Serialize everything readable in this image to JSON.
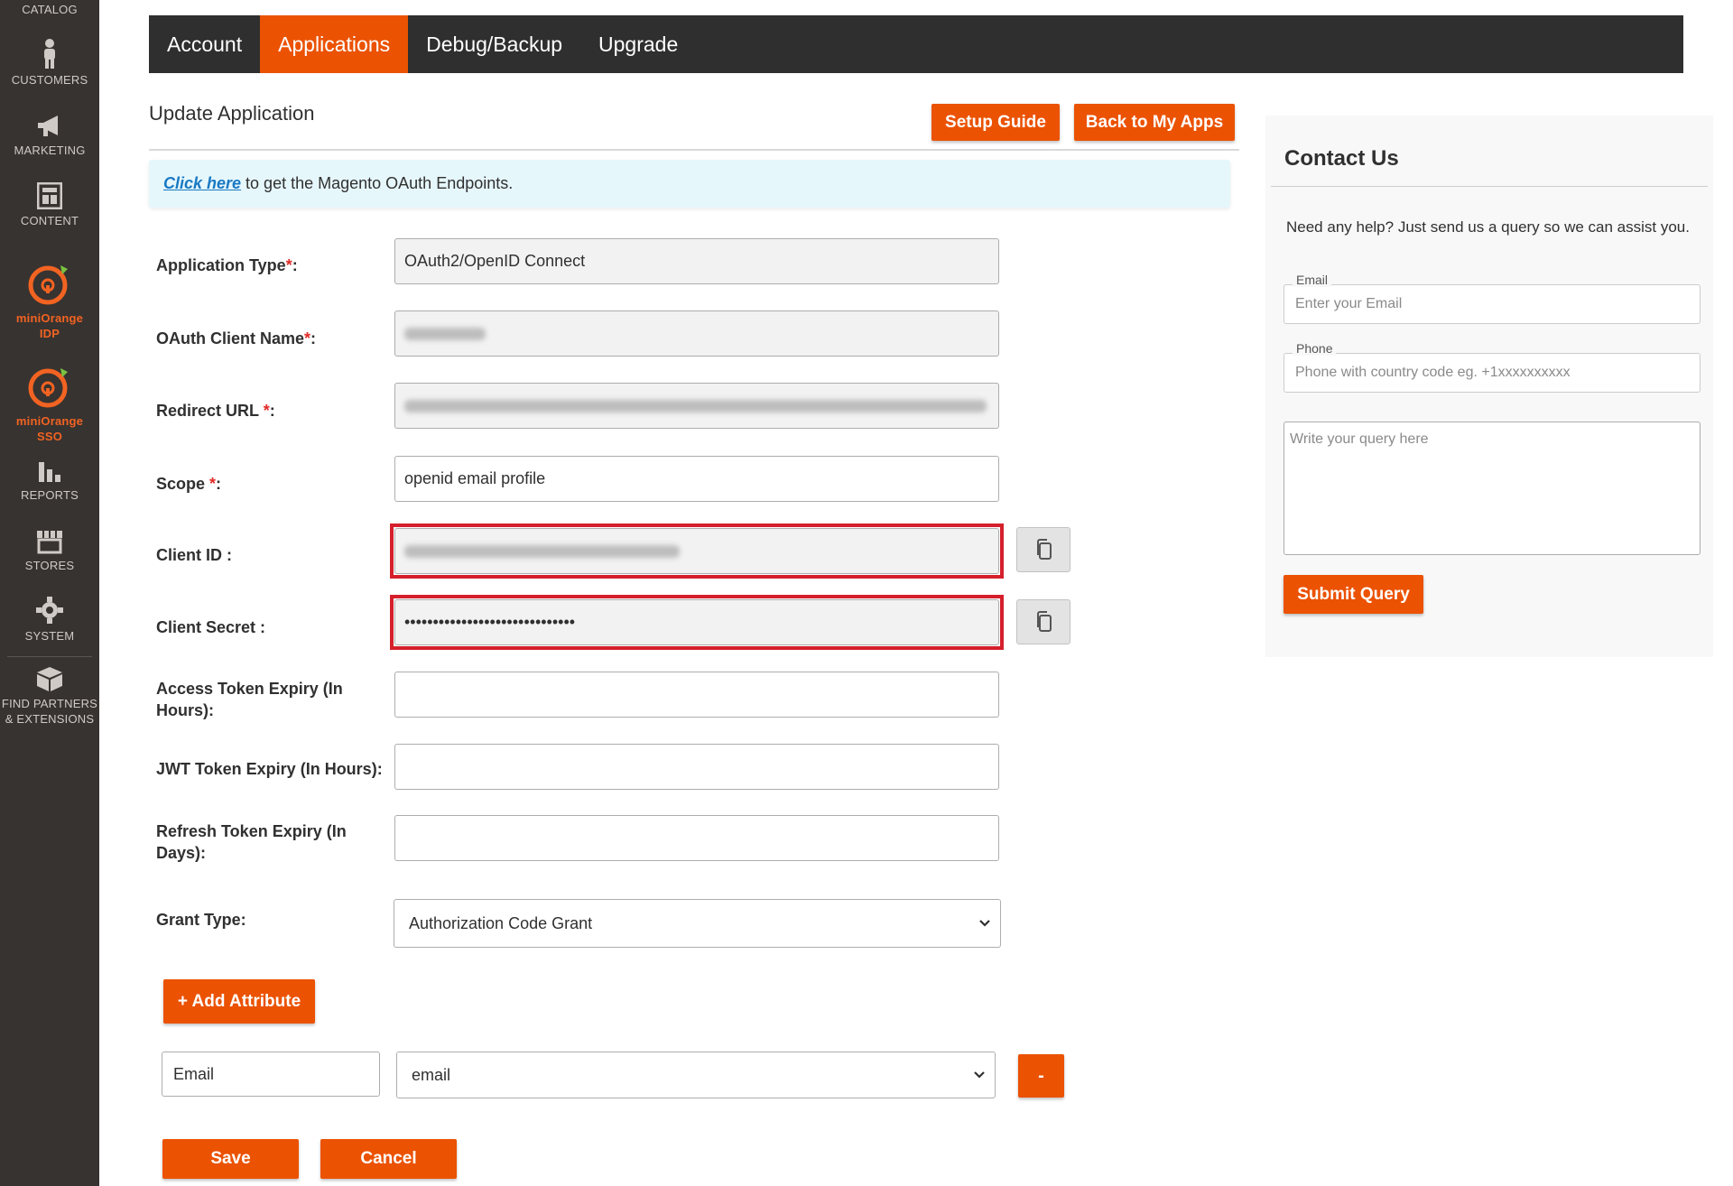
{
  "sidebar": {
    "items": [
      {
        "label": "CATALOG"
      },
      {
        "label": "CUSTOMERS"
      },
      {
        "label": "MARKETING"
      },
      {
        "label": "CONTENT"
      },
      {
        "label_line1": "miniOrange",
        "label_line2": "IDP"
      },
      {
        "label_line1": "miniOrange",
        "label_line2": "SSO"
      },
      {
        "label": "REPORTS"
      },
      {
        "label": "STORES"
      },
      {
        "label": "SYSTEM"
      },
      {
        "label_line1": "FIND PARTNERS",
        "label_line2": "& EXTENSIONS"
      }
    ]
  },
  "topnav": {
    "tabs": [
      {
        "label": "Account"
      },
      {
        "label": "Applications"
      },
      {
        "label": "Debug/Backup"
      },
      {
        "label": "Upgrade"
      }
    ]
  },
  "header": {
    "title": "Update Application",
    "setup_guide": "Setup Guide",
    "back_to_apps": "Back to My Apps"
  },
  "info": {
    "link": "Click here",
    "text": " to get the Magento OAuth Endpoints."
  },
  "form": {
    "app_type": {
      "label": "Application Type",
      "value": "OAuth2/OpenID Connect"
    },
    "client_name": {
      "label": "OAuth Client Name"
    },
    "redirect_url": {
      "label": "Redirect URL "
    },
    "scope": {
      "label": "Scope ",
      "value": "openid email profile"
    },
    "client_id": {
      "label": "Client ID :"
    },
    "client_secret": {
      "label": "Client Secret :",
      "value": "••••••••••••••••••••••••••••••"
    },
    "access_token_expiry": {
      "label": "Access Token Expiry (In Hours):"
    },
    "jwt_token_expiry": {
      "label": "JWT Token Expiry (In Hours):"
    },
    "refresh_token_expiry": {
      "label": "Refresh Token Expiry (In Days):"
    },
    "grant_type": {
      "label": "Grant Type:",
      "value": "Authorization Code Grant"
    },
    "required_mark": "*",
    "colon": ":",
    "add_attribute": "+ Add Attribute",
    "attribute": {
      "name": "Email",
      "value": "email",
      "remove_label": "-"
    },
    "save": "Save",
    "cancel": "Cancel"
  },
  "contact": {
    "title": "Contact Us",
    "text": "Need any help? Just send us a query so we can assist you.",
    "email_label": "Email",
    "email_placeholder": "Enter your Email",
    "phone_label": "Phone",
    "phone_placeholder": "Phone with country code eg. +1xxxxxxxxxx",
    "query_placeholder": "Write your query here",
    "submit": "Submit Query"
  },
  "colors": {
    "accent": "#eb5202",
    "sidebar_bg": "#373330",
    "topnav_bg": "#2f2f2f",
    "highlight_frame": "#d5202c"
  }
}
